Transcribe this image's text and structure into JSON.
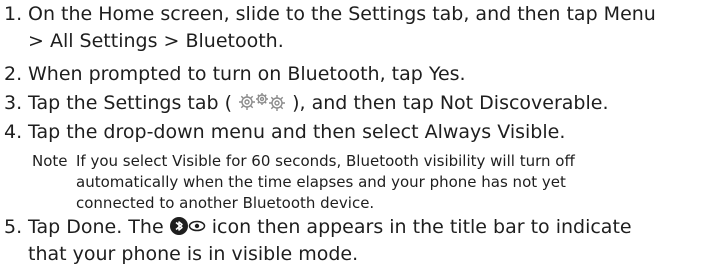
{
  "steps": [
    {
      "number": "1.",
      "line1_a": "On the Home screen, slide to the Settings tab, and then tap ",
      "line1_b": "Menu",
      "line2": "> All Settings > Bluetooth",
      "line2_end": "."
    },
    {
      "number": "2.",
      "a": "When prompted to turn on Bluetooth, tap ",
      "b": "Yes",
      "c": "."
    },
    {
      "number": "3.",
      "a": "Tap the Settings tab ( ",
      "b": " ), and then tap ",
      "c": "Not Discoverable",
      "d": ".",
      "icon": "settings-gears-icon"
    },
    {
      "number": "4.",
      "a": "Tap the drop-down menu and then select ",
      "b": "Always Visible",
      "c": "."
    },
    {
      "number": "5.",
      "a": "Tap ",
      "b": "Done",
      "c": ". The ",
      "d": " icon then appears in the title bar to indicate",
      "line2": "that your phone is in visible mode.",
      "icon": "bluetooth-visible-icon"
    }
  ],
  "note": {
    "label": "Note",
    "line1_a": "If you select ",
    "line1_b": "Visible for 60 seconds",
    "line1_c": ", Bluetooth visibility will turn off",
    "line2": "automatically when the time elapses and your phone has not yet",
    "line3": "connected to another Bluetooth device."
  },
  "colors": {
    "text": "#1e1e1e",
    "icon_gray": "#8c8c8c"
  }
}
